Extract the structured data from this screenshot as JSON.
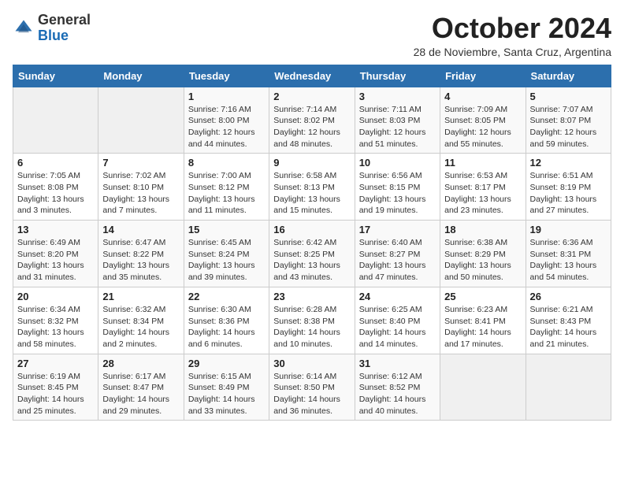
{
  "logo": {
    "general": "General",
    "blue": "Blue"
  },
  "header": {
    "title": "October 2024",
    "subtitle": "28 de Noviembre, Santa Cruz, Argentina"
  },
  "weekdays": [
    "Sunday",
    "Monday",
    "Tuesday",
    "Wednesday",
    "Thursday",
    "Friday",
    "Saturday"
  ],
  "weeks": [
    [
      {
        "day": "",
        "info": ""
      },
      {
        "day": "",
        "info": ""
      },
      {
        "day": "1",
        "info": "Sunrise: 7:16 AM\nSunset: 8:00 PM\nDaylight: 12 hours and 44 minutes."
      },
      {
        "day": "2",
        "info": "Sunrise: 7:14 AM\nSunset: 8:02 PM\nDaylight: 12 hours and 48 minutes."
      },
      {
        "day": "3",
        "info": "Sunrise: 7:11 AM\nSunset: 8:03 PM\nDaylight: 12 hours and 51 minutes."
      },
      {
        "day": "4",
        "info": "Sunrise: 7:09 AM\nSunset: 8:05 PM\nDaylight: 12 hours and 55 minutes."
      },
      {
        "day": "5",
        "info": "Sunrise: 7:07 AM\nSunset: 8:07 PM\nDaylight: 12 hours and 59 minutes."
      }
    ],
    [
      {
        "day": "6",
        "info": "Sunrise: 7:05 AM\nSunset: 8:08 PM\nDaylight: 13 hours and 3 minutes."
      },
      {
        "day": "7",
        "info": "Sunrise: 7:02 AM\nSunset: 8:10 PM\nDaylight: 13 hours and 7 minutes."
      },
      {
        "day": "8",
        "info": "Sunrise: 7:00 AM\nSunset: 8:12 PM\nDaylight: 13 hours and 11 minutes."
      },
      {
        "day": "9",
        "info": "Sunrise: 6:58 AM\nSunset: 8:13 PM\nDaylight: 13 hours and 15 minutes."
      },
      {
        "day": "10",
        "info": "Sunrise: 6:56 AM\nSunset: 8:15 PM\nDaylight: 13 hours and 19 minutes."
      },
      {
        "day": "11",
        "info": "Sunrise: 6:53 AM\nSunset: 8:17 PM\nDaylight: 13 hours and 23 minutes."
      },
      {
        "day": "12",
        "info": "Sunrise: 6:51 AM\nSunset: 8:19 PM\nDaylight: 13 hours and 27 minutes."
      }
    ],
    [
      {
        "day": "13",
        "info": "Sunrise: 6:49 AM\nSunset: 8:20 PM\nDaylight: 13 hours and 31 minutes."
      },
      {
        "day": "14",
        "info": "Sunrise: 6:47 AM\nSunset: 8:22 PM\nDaylight: 13 hours and 35 minutes."
      },
      {
        "day": "15",
        "info": "Sunrise: 6:45 AM\nSunset: 8:24 PM\nDaylight: 13 hours and 39 minutes."
      },
      {
        "day": "16",
        "info": "Sunrise: 6:42 AM\nSunset: 8:25 PM\nDaylight: 13 hours and 43 minutes."
      },
      {
        "day": "17",
        "info": "Sunrise: 6:40 AM\nSunset: 8:27 PM\nDaylight: 13 hours and 47 minutes."
      },
      {
        "day": "18",
        "info": "Sunrise: 6:38 AM\nSunset: 8:29 PM\nDaylight: 13 hours and 50 minutes."
      },
      {
        "day": "19",
        "info": "Sunrise: 6:36 AM\nSunset: 8:31 PM\nDaylight: 13 hours and 54 minutes."
      }
    ],
    [
      {
        "day": "20",
        "info": "Sunrise: 6:34 AM\nSunset: 8:32 PM\nDaylight: 13 hours and 58 minutes."
      },
      {
        "day": "21",
        "info": "Sunrise: 6:32 AM\nSunset: 8:34 PM\nDaylight: 14 hours and 2 minutes."
      },
      {
        "day": "22",
        "info": "Sunrise: 6:30 AM\nSunset: 8:36 PM\nDaylight: 14 hours and 6 minutes."
      },
      {
        "day": "23",
        "info": "Sunrise: 6:28 AM\nSunset: 8:38 PM\nDaylight: 14 hours and 10 minutes."
      },
      {
        "day": "24",
        "info": "Sunrise: 6:25 AM\nSunset: 8:40 PM\nDaylight: 14 hours and 14 minutes."
      },
      {
        "day": "25",
        "info": "Sunrise: 6:23 AM\nSunset: 8:41 PM\nDaylight: 14 hours and 17 minutes."
      },
      {
        "day": "26",
        "info": "Sunrise: 6:21 AM\nSunset: 8:43 PM\nDaylight: 14 hours and 21 minutes."
      }
    ],
    [
      {
        "day": "27",
        "info": "Sunrise: 6:19 AM\nSunset: 8:45 PM\nDaylight: 14 hours and 25 minutes."
      },
      {
        "day": "28",
        "info": "Sunrise: 6:17 AM\nSunset: 8:47 PM\nDaylight: 14 hours and 29 minutes."
      },
      {
        "day": "29",
        "info": "Sunrise: 6:15 AM\nSunset: 8:49 PM\nDaylight: 14 hours and 33 minutes."
      },
      {
        "day": "30",
        "info": "Sunrise: 6:14 AM\nSunset: 8:50 PM\nDaylight: 14 hours and 36 minutes."
      },
      {
        "day": "31",
        "info": "Sunrise: 6:12 AM\nSunset: 8:52 PM\nDaylight: 14 hours and 40 minutes."
      },
      {
        "day": "",
        "info": ""
      },
      {
        "day": "",
        "info": ""
      }
    ]
  ]
}
